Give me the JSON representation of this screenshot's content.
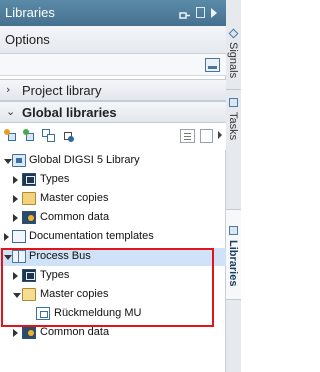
{
  "panel": {
    "title": "Libraries",
    "options": {
      "label": "Options"
    },
    "sections": {
      "project_library": {
        "label": "Project library",
        "chevron": "›"
      },
      "global_libraries": {
        "label": "Global libraries",
        "chevron": "⌄"
      }
    },
    "tree": [
      {
        "label": "Global DIGSI 5 Library",
        "icon": "library-icon"
      },
      {
        "label": "Types",
        "icon": "types-icon"
      },
      {
        "label": "Master copies",
        "icon": "folder-icon"
      },
      {
        "label": "Common data",
        "icon": "common-data-icon"
      },
      {
        "label": "Documentation templates",
        "icon": "book-icon"
      },
      {
        "label": "Process Bus",
        "icon": "book-icon"
      },
      {
        "label": "Types",
        "icon": "types-icon"
      },
      {
        "label": "Master copies",
        "icon": "folder-open-icon"
      },
      {
        "label": "Rückmeldung MU",
        "icon": "element-icon"
      },
      {
        "label": "Common data",
        "icon": "common-data-icon"
      }
    ]
  },
  "side_tabs": [
    "Signals",
    "Tasks",
    "Libraries"
  ],
  "colors": {
    "title_bar": "#4f7f9f",
    "highlight_box": "#e0141b",
    "selected_row": "#cfe2f7"
  }
}
